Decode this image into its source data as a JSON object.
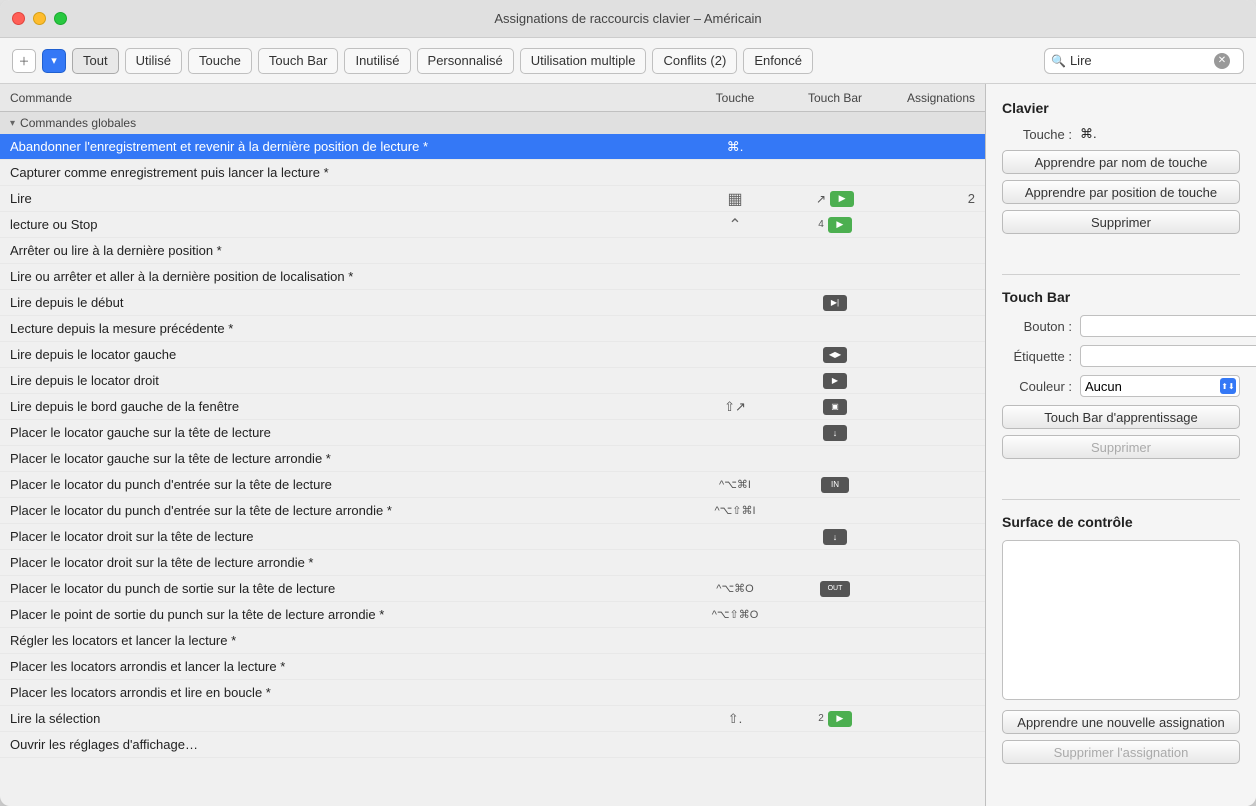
{
  "window": {
    "title": "Assignations de raccourcis clavier – Américain"
  },
  "toolbar": {
    "add_icon": "＋",
    "dropdown_icon": "▼",
    "filters": [
      {
        "label": "Tout",
        "active": true
      },
      {
        "label": "Utilisé",
        "active": false
      },
      {
        "label": "Touche",
        "active": false
      },
      {
        "label": "Touch Bar",
        "active": false
      },
      {
        "label": "Inutilisé",
        "active": false
      },
      {
        "label": "Personnalisé",
        "active": false
      },
      {
        "label": "Utilisation multiple",
        "active": false
      },
      {
        "label": "Conflits (2)",
        "active": false
      },
      {
        "label": "Enfoncé",
        "active": false
      }
    ],
    "search_placeholder": "Lire"
  },
  "table": {
    "headers": {
      "commande": "Commande",
      "touche": "Touche",
      "touch_bar": "Touch Bar",
      "assignations": "Assignations"
    },
    "group_label": "Commandes globales",
    "rows": [
      {
        "label": "Abandonner l'enregistrement et revenir à la dernière position de lecture *",
        "shortcut": "⌘.",
        "touchbar": "",
        "assignations": "",
        "selected": true
      },
      {
        "label": "Capturer comme enregistrement puis lancer la lecture *",
        "shortcut": "",
        "touchbar": "",
        "assignations": "",
        "selected": false
      },
      {
        "label": "Lire",
        "shortcut": "▦",
        "touchbar_icon": "↗",
        "touchbar_btn": "▶",
        "assignations": "2",
        "selected": false
      },
      {
        "label": "lecture ou Stop",
        "shortcut": "⌃",
        "touchbar_num": "4",
        "touchbar_btn": "▶",
        "assignations": "",
        "selected": false
      },
      {
        "label": "Arrêter ou lire à la dernière position *",
        "shortcut": "",
        "touchbar": "",
        "assignations": "",
        "selected": false
      },
      {
        "label": "Lire ou arrêter et aller à la dernière position de localisation *",
        "shortcut": "",
        "touchbar": "",
        "assignations": "",
        "selected": false
      },
      {
        "label": "Lire depuis le début",
        "shortcut": "",
        "touchbar_btn": "▶|",
        "assignations": "",
        "selected": false
      },
      {
        "label": "Lecture depuis la mesure précédente *",
        "shortcut": "",
        "touchbar": "",
        "assignations": "",
        "selected": false
      },
      {
        "label": "Lire depuis le locator gauche",
        "shortcut": "",
        "touchbar_btn": "◀▶",
        "assignations": "",
        "selected": false
      },
      {
        "label": "Lire depuis le locator droit",
        "shortcut": "",
        "touchbar_btn": "▶",
        "assignations": "",
        "selected": false
      },
      {
        "label": "Lire depuis le bord gauche de la fenêtre",
        "shortcut": "⇧↗",
        "touchbar_btn": "▣",
        "assignations": "",
        "selected": false
      },
      {
        "label": "Placer le locator gauche sur la tête de lecture",
        "shortcut": "",
        "touchbar_btn": "↓",
        "assignations": "",
        "selected": false
      },
      {
        "label": "Placer le locator gauche sur la tête de lecture arrondie *",
        "shortcut": "",
        "touchbar": "",
        "assignations": "",
        "selected": false
      },
      {
        "label": "Placer le locator du punch d'entrée sur la tête de lecture",
        "shortcut": "^⌥⌘I",
        "touchbar_btn": "IN",
        "assignations": "",
        "selected": false
      },
      {
        "label": "Placer le locator du punch d'entrée sur la tête de lecture arrondie *",
        "shortcut": "^⌥⇧⌘I",
        "touchbar": "",
        "assignations": "",
        "selected": false
      },
      {
        "label": "Placer le locator droit sur la tête de lecture",
        "shortcut": "",
        "touchbar_btn": "↓",
        "assignations": "",
        "selected": false
      },
      {
        "label": "Placer le locator droit sur la tête de lecture arrondie *",
        "shortcut": "",
        "touchbar": "",
        "assignations": "",
        "selected": false
      },
      {
        "label": "Placer le locator du punch de sortie sur la tête de lecture",
        "shortcut": "^⌥⌘O",
        "touchbar_btn": "OUT",
        "assignations": "",
        "selected": false
      },
      {
        "label": "Placer le point de sortie du punch sur la tête de lecture arrondie *",
        "shortcut": "^⌥⇧⌘O",
        "touchbar": "",
        "assignations": "",
        "selected": false
      },
      {
        "label": "Régler les locators et lancer la lecture *",
        "shortcut": "",
        "touchbar": "",
        "assignations": "",
        "selected": false
      },
      {
        "label": "Placer les locators arrondis et lancer la lecture *",
        "shortcut": "",
        "touchbar": "",
        "assignations": "",
        "selected": false
      },
      {
        "label": "Placer les locators arrondis et lire en boucle *",
        "shortcut": "",
        "touchbar": "",
        "assignations": "",
        "selected": false
      },
      {
        "label": "Lire la sélection",
        "shortcut": "⇧.",
        "touchbar_num": "2",
        "touchbar_btn": "▶",
        "assignations": "",
        "selected": false
      },
      {
        "label": "Ouvrir les réglages d'affichage…",
        "shortcut": "",
        "touchbar": "",
        "assignations": "",
        "selected": false
      }
    ]
  },
  "right_panel": {
    "clavier": {
      "title": "Clavier",
      "touche_label": "Touche :",
      "touche_value": "⌘.",
      "btn_apprendre_nom": "Apprendre par nom de touche",
      "btn_apprendre_pos": "Apprendre par position de touche",
      "btn_supprimer": "Supprimer"
    },
    "touch_bar": {
      "title": "Touch Bar",
      "bouton_label": "Bouton :",
      "etiquette_label": "Étiquette :",
      "couleur_label": "Couleur :",
      "couleur_value": "Aucun",
      "btn_touch_bar": "Touch Bar d'apprentissage",
      "btn_supprimer": "Supprimer"
    },
    "surface": {
      "title": "Surface de contrôle",
      "btn_apprendre": "Apprendre une nouvelle assignation",
      "btn_supprimer": "Supprimer l'assignation"
    }
  }
}
